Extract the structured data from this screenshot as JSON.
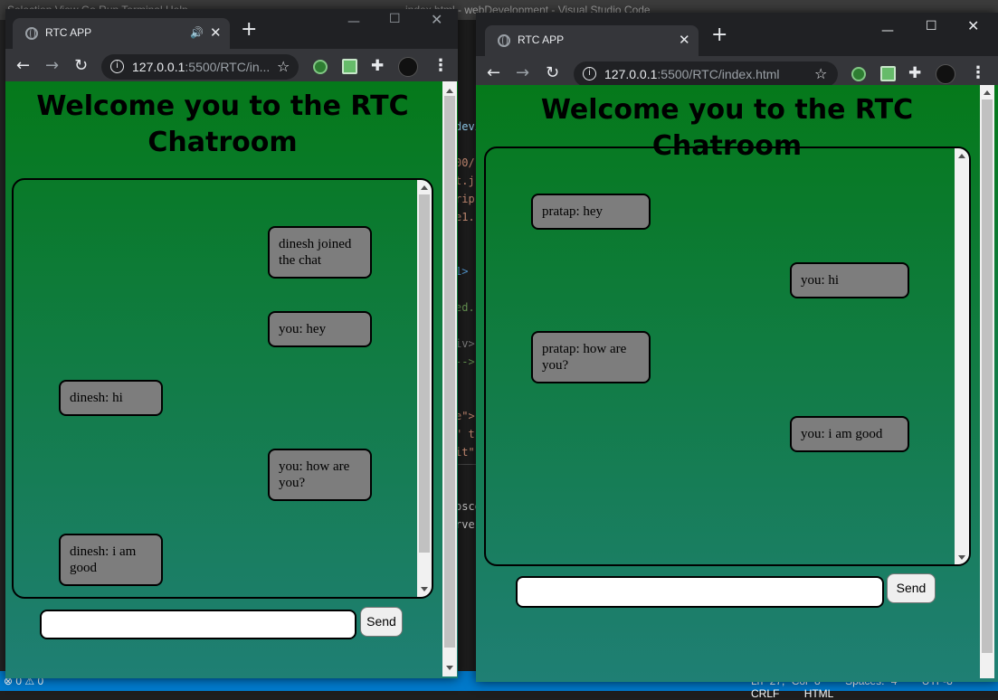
{
  "vscode": {
    "menu_text": "Selection  View  Go  Run  Terminal  Help",
    "window_title": "index.html - webDevelopment - Visual Studio Code",
    "code_lines": [
      {
        "text": "devi",
        "color": "#9cdcfe"
      },
      {
        "text": "",
        "color": "#ccc"
      },
      {
        "text": "00/",
        "color": "#ce9178"
      },
      {
        "text": "t.j",
        "color": "#ce9178"
      },
      {
        "text": "rip",
        "color": "#ce9178"
      },
      {
        "text": "e1.",
        "color": "#ce9178"
      },
      {
        "text": "",
        "color": "#ccc"
      },
      {
        "text": "",
        "color": "#ccc"
      },
      {
        "text": "1>",
        "color": "#569cd6"
      },
      {
        "text": "",
        "color": "#ccc"
      },
      {
        "text": "ed.",
        "color": "#6a9955"
      },
      {
        "text": "",
        "color": "#ccc"
      },
      {
        "text": "iv>",
        "color": "#808080"
      },
      {
        "text": "-->",
        "color": "#6a9955"
      },
      {
        "text": "",
        "color": "#ccc"
      },
      {
        "text": "",
        "color": "#ccc"
      },
      {
        "text": "e\">",
        "color": "#ce9178"
      },
      {
        "text": "\" t",
        "color": "#ce9178"
      },
      {
        "text": "it\"",
        "color": "#ce9178"
      }
    ],
    "panel_lines": [
      "psco",
      "rve"
    ],
    "status": {
      "problems": "⊗ 0 ⚠ 0",
      "position": "Ln 27, Col 8",
      "spaces": "Spaces: 4",
      "encoding": "UTF-8",
      "eol": "CRLF",
      "language": "HTML"
    }
  },
  "left_browser": {
    "tab_title": "RTC APP",
    "audio_icon": "speaker-icon",
    "url_host": "127.0.0.1",
    "url_rest": ":5500/RTC/in...",
    "heading": "Welcome you to the RTC Chatroom",
    "messages": [
      {
        "text": "dinesh joined the chat",
        "side": "right"
      },
      {
        "text": "you: hey",
        "side": "right"
      },
      {
        "text": "dinesh: hi",
        "side": "left"
      },
      {
        "text": "you: how are you?",
        "side": "right"
      },
      {
        "text": "dinesh: i am good",
        "side": "left"
      }
    ],
    "input_value": "",
    "send_label": "Send"
  },
  "right_browser": {
    "tab_title": "RTC APP",
    "url_host": "127.0.0.1",
    "url_rest": ":5500/RTC/index.html",
    "heading": "Welcome you to the RTC Chatroom",
    "messages": [
      {
        "text": "pratap: hey",
        "side": "left"
      },
      {
        "text": "you: hi",
        "side": "right"
      },
      {
        "text": "pratap: how are you?",
        "side": "left"
      },
      {
        "text": "you: i am good",
        "side": "right"
      }
    ],
    "input_value": "",
    "send_label": "Send"
  },
  "colors": {
    "page_gradient_top": "#05791a",
    "page_gradient_bottom": "#1f7f74",
    "bubble": "#7d7d7d",
    "chrome_frame": "#202124",
    "chrome_toolbar": "#35363a",
    "vscode_status": "#007acc"
  }
}
